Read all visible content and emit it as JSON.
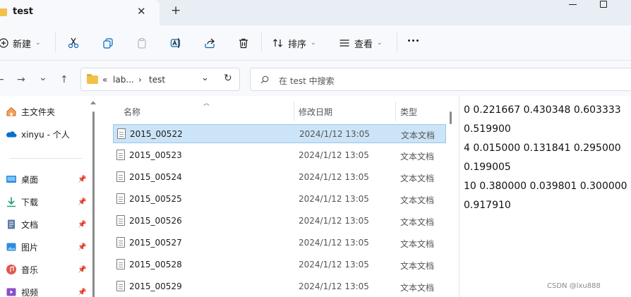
{
  "tab": {
    "title": "test",
    "close": "✕",
    "add": "+"
  },
  "toolbar": {
    "new_label": "新建",
    "sort_label": "排序",
    "view_label": "查看",
    "caret": "⌄"
  },
  "nav": {
    "back": "←",
    "forward": "→",
    "dropdown": "⌄",
    "up": "↑"
  },
  "address": {
    "more": "«",
    "crumbs": [
      "lab...",
      "test"
    ],
    "sep": "›",
    "dropdown": "⌄",
    "refresh": "↻"
  },
  "search": {
    "placeholder": "在 test 中搜索"
  },
  "sidebar": {
    "items": [
      {
        "label": "主文件夹",
        "icon": "home-icon"
      },
      {
        "label": "xinyu - 个人",
        "icon": "onedrive-cloud-icon"
      },
      {
        "label": "桌面",
        "icon": "desktop-icon",
        "pinned": true
      },
      {
        "label": "下载",
        "icon": "download-icon",
        "pinned": true
      },
      {
        "label": "文档",
        "icon": "document-icon",
        "pinned": true
      },
      {
        "label": "图片",
        "icon": "pictures-icon",
        "pinned": true
      },
      {
        "label": "音乐",
        "icon": "music-icon",
        "pinned": true
      },
      {
        "label": "视频",
        "icon": "video-icon",
        "pinned": true
      }
    ]
  },
  "list": {
    "columns": {
      "name": "名称",
      "date": "修改日期",
      "type": "类型"
    },
    "rows": [
      {
        "name": "2015_00522",
        "date": "2024/1/12 13:05",
        "type": "文本文档",
        "selected": true
      },
      {
        "name": "2015_00523",
        "date": "2024/1/12 13:05",
        "type": "文本文档"
      },
      {
        "name": "2015_00524",
        "date": "2024/1/12 13:05",
        "type": "文本文档"
      },
      {
        "name": "2015_00525",
        "date": "2024/1/12 13:05",
        "type": "文本文档"
      },
      {
        "name": "2015_00526",
        "date": "2024/1/12 13:05",
        "type": "文本文档"
      },
      {
        "name": "2015_00527",
        "date": "2024/1/12 13:05",
        "type": "文本文档"
      },
      {
        "name": "2015_00528",
        "date": "2024/1/12 13:05",
        "type": "文本文档"
      },
      {
        "name": "2015_00529",
        "date": "2024/1/12 13:05",
        "type": "文本文档"
      }
    ]
  },
  "preview": {
    "lines": [
      "0 0.221667 0.430348 0.603333",
      "0.519900",
      "4 0.015000 0.131841 0.295000",
      "0.199005",
      "10 0.380000 0.039801 0.300000",
      "0.917910"
    ]
  },
  "watermark": "CSDN @lxu888",
  "colors": {
    "accent": "#0067c0",
    "selection": "#cce4f7",
    "folder": "#f2c14c"
  }
}
